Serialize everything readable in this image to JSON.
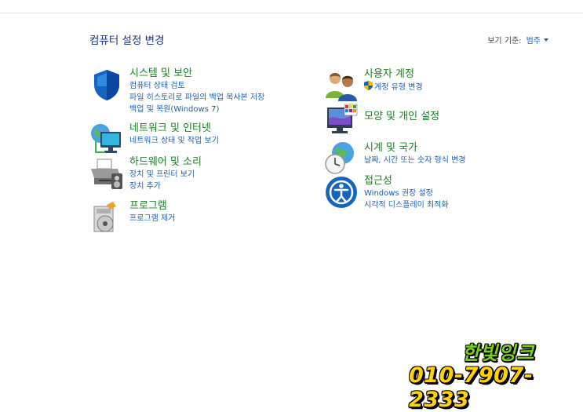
{
  "header": {
    "title": "컴퓨터 설정 변경",
    "view_by_label": "보기 기준:",
    "view_by_value": "범주"
  },
  "categories": {
    "system": {
      "icon": "shield-icon",
      "title": "시스템 및 보안",
      "links": [
        "컴퓨터 상태 검토",
        "파일 히스토리로 파일의 백업 복사본 저장",
        "백업 및 복원(Windows 7)"
      ]
    },
    "network": {
      "icon": "network-globe-icon",
      "title": "네트워크 및 인터넷",
      "links": [
        "네트워크 상태 및 작업 보기"
      ]
    },
    "hardware": {
      "icon": "printer-icon",
      "title": "하드웨어 및 소리",
      "links": [
        "장치 및 프린터 보기",
        "장치 추가"
      ]
    },
    "programs": {
      "icon": "programs-icon",
      "title": "프로그램",
      "links": [
        "프로그램 제거"
      ]
    },
    "users": {
      "icon": "users-icon",
      "title": "사용자 계정",
      "links": [
        "계정 유형 변경"
      ]
    },
    "appearance": {
      "icon": "appearance-icon",
      "title": "모양 및 개인 설정",
      "links": []
    },
    "clock": {
      "icon": "clock-globe-icon",
      "title": "시계 및 국가",
      "links": [
        "날짜, 시간 또는 숫자 형식 변경"
      ]
    },
    "access": {
      "icon": "ease-of-access-icon",
      "title": "접근성",
      "links": [
        "Windows 권장 설정",
        "시각적 디스플레이 최적화"
      ]
    }
  },
  "watermark": {
    "name": "한빛잉크",
    "phone": "010-7907-2333",
    "name_color": "#7ad11a",
    "phone_color": "#ffd200"
  },
  "colors": {
    "heading": "#1a8024",
    "link": "#1a5fb4",
    "title": "#1e3287"
  }
}
